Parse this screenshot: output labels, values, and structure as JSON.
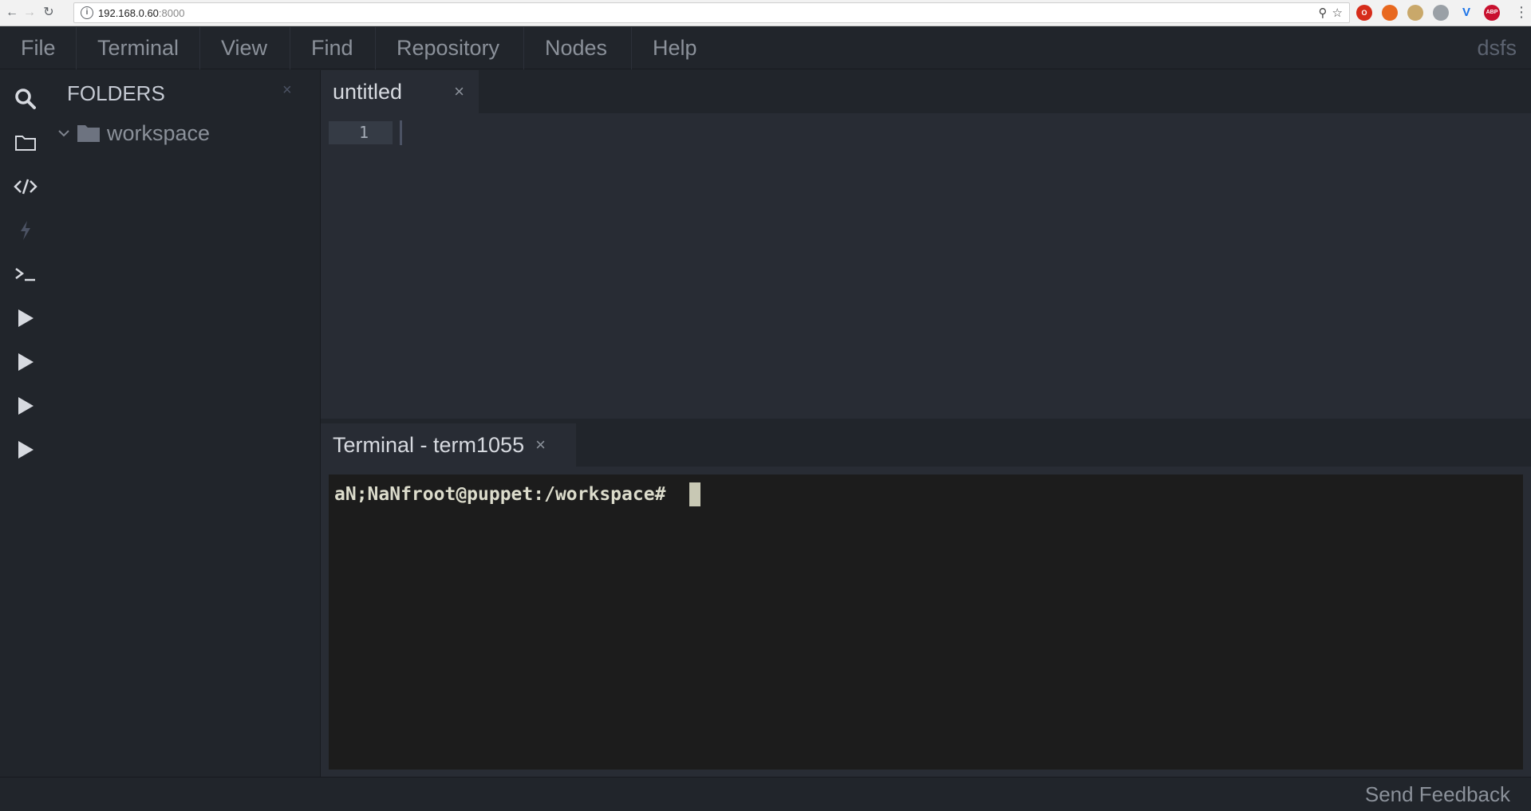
{
  "browser": {
    "url_host": "192.168.0.60",
    "url_port": ":8000",
    "extensions": [
      {
        "name": "opera-icon",
        "color": "#d62c1a",
        "label": "O"
      },
      {
        "name": "fox-icon",
        "color": "#e8681f",
        "label": ""
      },
      {
        "name": "character-icon",
        "color": "#c9a86a",
        "label": ""
      },
      {
        "name": "cube-icon",
        "color": "#9aa0a6",
        "label": ""
      },
      {
        "name": "v-icon",
        "color": "#1a73e8",
        "label": "V"
      },
      {
        "name": "adblock-icon",
        "color": "#c8102e",
        "label": "ABP"
      }
    ]
  },
  "menu": {
    "items": [
      "File",
      "Terminal",
      "View",
      "Find",
      "Repository",
      "Nodes",
      "Help"
    ],
    "user": "dsfs"
  },
  "sidebar": {
    "title": "FOLDERS",
    "close": "×",
    "tree": [
      {
        "label": "workspace",
        "expanded": true
      }
    ]
  },
  "editor": {
    "tab_label": "untitled",
    "tab_close": "×",
    "line_number": "1"
  },
  "panel": {
    "tab_label": "Terminal - term1055",
    "tab_close": "×"
  },
  "terminal": {
    "prompt": "aN;NaNfroot@puppet:/workspace# "
  },
  "status": {
    "feedback": "Send Feedback"
  },
  "activity": [
    "search-icon",
    "folder-icon",
    "code-icon",
    "bolt-icon",
    "terminal-icon",
    "play-icon",
    "play-icon",
    "play-icon",
    "play-icon"
  ]
}
